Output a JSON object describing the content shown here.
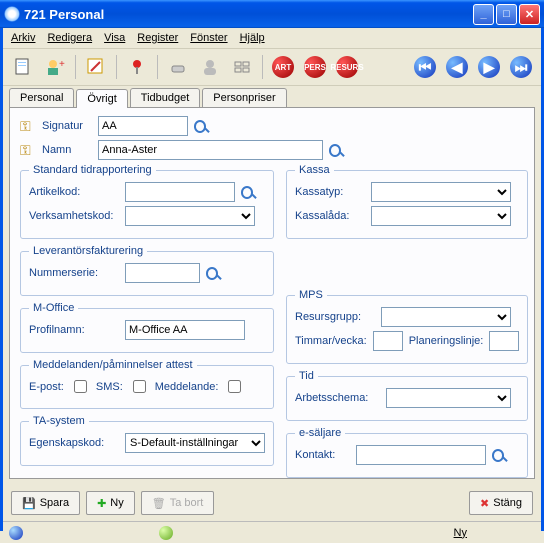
{
  "window": {
    "title": "721 Personal"
  },
  "menu": {
    "arkiv": "Arkiv",
    "redigera": "Redigera",
    "visa": "Visa",
    "register": "Register",
    "fonster": "Fönster",
    "hjalp": "Hjälp"
  },
  "toolbar_badges": {
    "art": "ART",
    "pers": "PERS",
    "resur": "RESURS"
  },
  "tabs": {
    "personal": "Personal",
    "ovrigt": "Övrigt",
    "tidbudget": "Tidbudget",
    "personpriser": "Personpriser"
  },
  "top": {
    "signatur_label": "Signatur",
    "signatur_value": "AA",
    "namn_label": "Namn",
    "namn_value": "Anna-Aster"
  },
  "groups": {
    "std": {
      "legend": "Standard tidrapportering",
      "artikelkod_label": "Artikelkod:",
      "artikelkod_value": "",
      "verk_label": "Verksamhetskod:",
      "verk_value": ""
    },
    "kassa": {
      "legend": "Kassa",
      "typ_label": "Kassatyp:",
      "typ_value": "",
      "lada_label": "Kassalåda:",
      "lada_value": ""
    },
    "lev": {
      "legend": "Leverantörsfakturering",
      "nummer_label": "Nummerserie:",
      "nummer_value": ""
    },
    "moffice": {
      "legend": "M-Office",
      "profil_label": "Profilnamn:",
      "profil_value": "M-Office AA"
    },
    "mps": {
      "legend": "MPS",
      "resurs_label": "Resursgrupp:",
      "resurs_value": "",
      "timmar_label": "Timmar/vecka:",
      "timmar_value": "",
      "plan_label": "Planeringslinje:",
      "plan_value": ""
    },
    "medd": {
      "legend": "Meddelanden/påminnelser attest",
      "epost_label": "E-post:",
      "sms_label": "SMS:",
      "meddelande_label": "Meddelande:"
    },
    "tid": {
      "legend": "Tid",
      "arbets_label": "Arbetsschema:",
      "arbets_value": ""
    },
    "ta": {
      "legend": "TA-system",
      "egen_label": "Egenskapskod:",
      "egen_value": "S-Default-inställningar"
    },
    "es": {
      "legend": "e-säljare",
      "kontakt_label": "Kontakt:",
      "kontakt_value": ""
    }
  },
  "footer": {
    "spara": "Spara",
    "ny": "Ny",
    "tabort": "Ta bort",
    "stang": "Stäng"
  },
  "status": {
    "ny": "Ny"
  }
}
